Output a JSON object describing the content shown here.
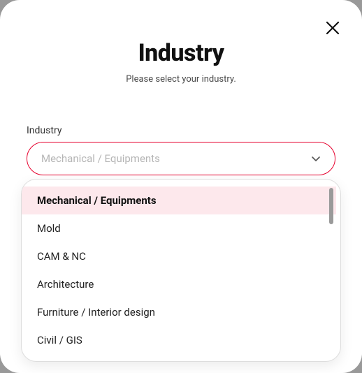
{
  "modal": {
    "title": "Industry",
    "subtitle": "Please select your industry."
  },
  "field": {
    "label": "Industry",
    "placeholder": "Mechanical / Equipments"
  },
  "options": [
    {
      "label": "Mechanical / Equipments",
      "selected": true
    },
    {
      "label": "Mold",
      "selected": false
    },
    {
      "label": "CAM & NC",
      "selected": false
    },
    {
      "label": "Architecture",
      "selected": false
    },
    {
      "label": "Furniture / Interior design",
      "selected": false
    },
    {
      "label": "Civil / GIS",
      "selected": false
    }
  ]
}
